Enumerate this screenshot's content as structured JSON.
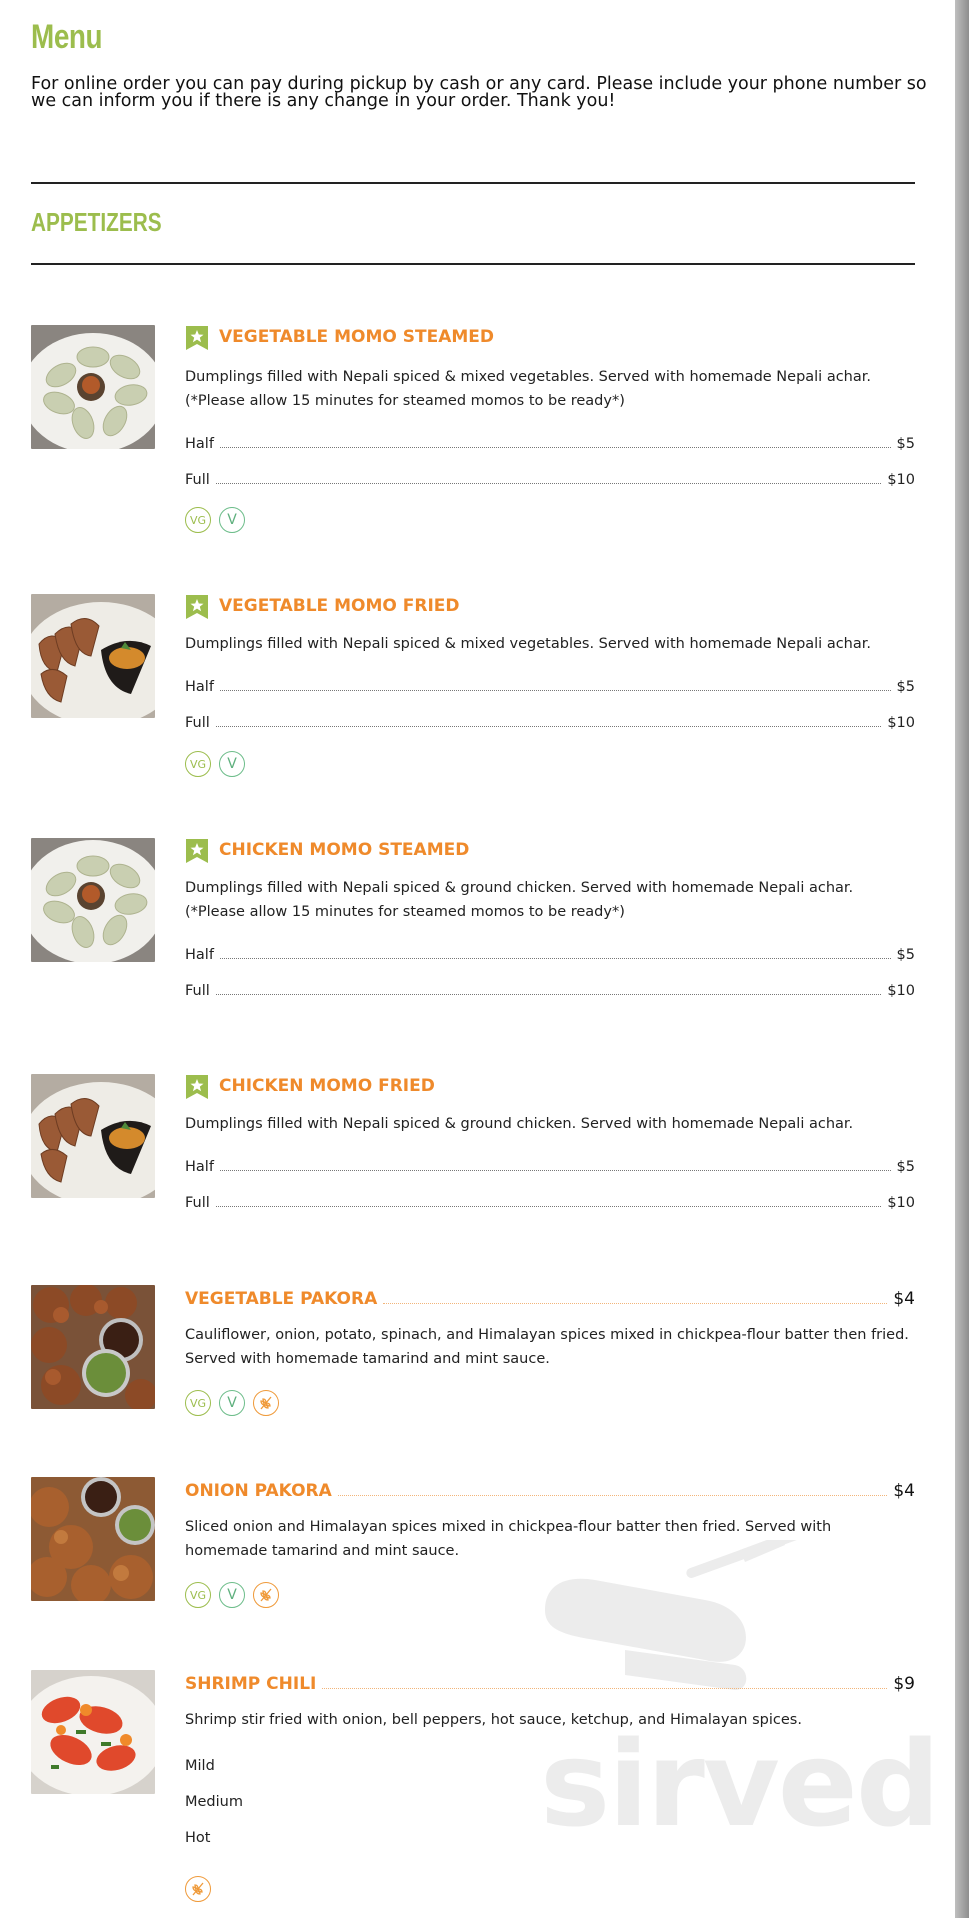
{
  "menu": {
    "title": "Menu",
    "intro": "For online order you can pay during pickup by cash or any card. Please include your phone number so we can inform you if there is any change in your order. Thank you!"
  },
  "section": {
    "title": "APPETIZERS"
  },
  "items": [
    {
      "name": "VEGETABLE MOMO STEAMED",
      "desc": "Dumplings filled with Nepali spiced & mixed vegetables. Served with homemade Nepali achar. (*Please allow 15 minutes for steamed momos to be ready*)",
      "prices": [
        {
          "label": "Half",
          "amount": "$5"
        },
        {
          "label": "Full",
          "amount": "$10"
        }
      ],
      "badges": [
        "VG",
        "V"
      ]
    },
    {
      "name": "VEGETABLE MOMO FRIED",
      "desc": "Dumplings filled with Nepali spiced & mixed vegetables. Served with homemade Nepali achar.",
      "prices": [
        {
          "label": "Half",
          "amount": "$5"
        },
        {
          "label": "Full",
          "amount": "$10"
        }
      ],
      "badges": [
        "VG",
        "V"
      ]
    },
    {
      "name": "CHICKEN MOMO STEAMED",
      "desc": "Dumplings filled with Nepali spiced & ground chicken. Served with homemade Nepali achar. (*Please allow 15 minutes for steamed momos to be ready*)",
      "prices": [
        {
          "label": "Half",
          "amount": "$5"
        },
        {
          "label": "Full",
          "amount": "$10"
        }
      ]
    },
    {
      "name": "CHICKEN MOMO FRIED",
      "desc": "Dumplings filled with Nepali spiced & ground chicken. Served with homemade Nepali achar.",
      "prices": [
        {
          "label": "Half",
          "amount": "$5"
        },
        {
          "label": "Full",
          "amount": "$10"
        }
      ]
    },
    {
      "name": "VEGETABLE PAKORA",
      "price": "$4",
      "desc": "Cauliflower, onion, potato, spinach, and Himalayan spices mixed in chickpea-flour batter then fried. Served with homemade tamarind and mint sauce.",
      "badges": [
        "VG",
        "V",
        "GF"
      ]
    },
    {
      "name": "ONION PAKORA",
      "price": "$4",
      "desc": "Sliced onion and Himalayan spices mixed in chickpea-flour batter then fried. Served with homemade tamarind and mint sauce.",
      "badges": [
        "VG",
        "V",
        "GF"
      ]
    },
    {
      "name": "SHRIMP CHILI",
      "price": "$9",
      "desc": "Shrimp stir fried with onion, bell peppers, hot sauce, ketchup, and Himalayan spices.",
      "options": [
        "Mild",
        "Medium",
        "Hot"
      ],
      "badges": [
        "GF"
      ]
    }
  ],
  "icons": {
    "vegan": "VG",
    "vegetarian": "V",
    "gluten_free": "wheat-icon",
    "featured": "star-bookmark-icon"
  },
  "watermark": "sirved",
  "colors": {
    "green": "#9cbd4d",
    "orange": "#ef8a2b",
    "teal": "#6dbd8a"
  }
}
